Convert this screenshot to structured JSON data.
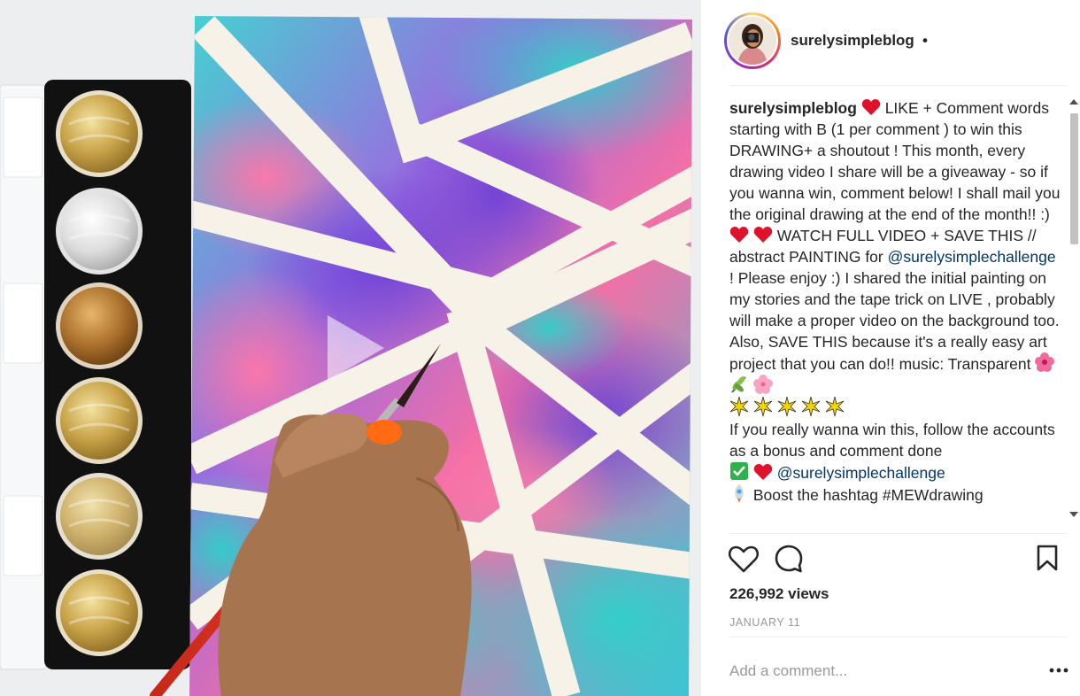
{
  "header": {
    "username": "surelysimpleblog",
    "separator": "•"
  },
  "caption": {
    "username": "surelysimpleblog",
    "text_1": "LIKE + Comment words starting with B (1 per comment ) to win this DRAWING+ a shoutout ! This month, every drawing video I share will be a giveaway - so if you wanna win, comment below! I shall mail you the original drawing at the end of the month!! :)",
    "text_2": "WATCH FULL VIDEO + SAVE THIS // abstract PAINTING for",
    "mention_1": "@surelysimplechallenge",
    "text_3": "! Please enjoy :) I shared the initial painting on my stories and the tape trick on LIVE , probably will make a proper video on the background too. Also, SAVE THIS because it's a really easy art project that you can do!! music: Transparent",
    "text_4": "If you really wanna win this, follow the accounts as a bonus and comment done",
    "mention_2": "@surelysimplechallenge",
    "text_5": "Boost the hashtag #MEWdrawing"
  },
  "stats": {
    "views": "226,992 views",
    "date": "JANUARY 11"
  },
  "comment": {
    "placeholder": "Add a comment..."
  },
  "icons": {
    "like": "heart-outline-icon",
    "comment": "speech-bubble-icon",
    "save": "bookmark-icon",
    "more": "ellipsis-icon",
    "play": "play-icon"
  },
  "colors": {
    "mention": "#003569",
    "muted": "#999999",
    "text": "#262626"
  }
}
